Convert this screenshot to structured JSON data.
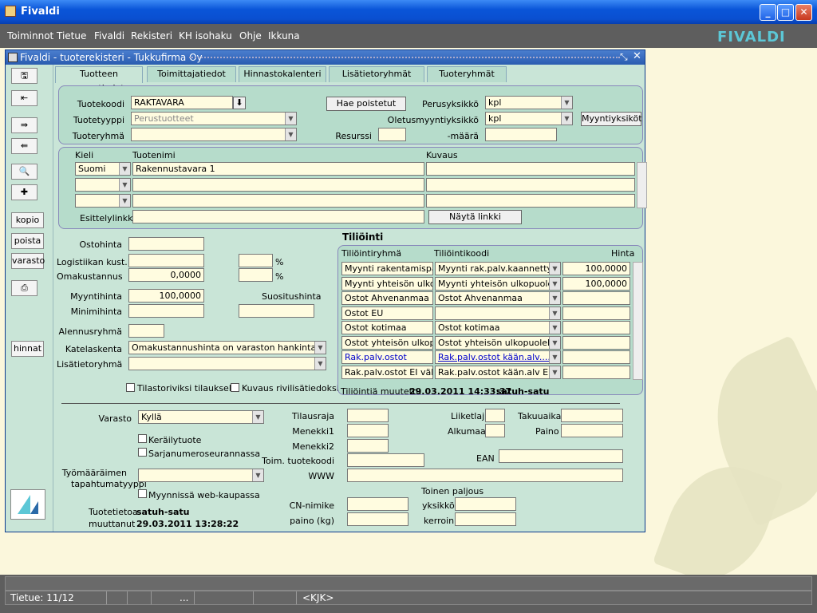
{
  "app": {
    "title": "Fivaldi",
    "logo": "FIVALDI"
  },
  "window_controls": [
    "minimize-icon",
    "maximize-icon",
    "close-icon"
  ],
  "menu": [
    "Toiminnot",
    "Tietue",
    "Fivaldi",
    "Rekisteri",
    "KH isohaku",
    "Ohje",
    "Ikkuna"
  ],
  "subwin": {
    "title": "Fivaldi - tuoterekisteri - Tukkufirma Oy"
  },
  "toolbar": {
    "kopio": "kopio",
    "poista": "poista",
    "varasto": "varasto",
    "hinnat": "hinnat"
  },
  "tabs": [
    "Tuotteen perustiedot",
    "Toimittajatiedot",
    "Hinnastokalenteri",
    "Lisätietoryhmät",
    "Tuoteryhmät"
  ],
  "basic": {
    "tuotekoodi_label": "Tuotekoodi",
    "tuotekoodi": "RAKTAVARA",
    "tuotetyyppi_label": "Tuotetyyppi",
    "tuotetyyppi": "Perustuotteet",
    "tuoteryhma_label": "Tuoteryhmä",
    "hae_button": "Hae poistetut",
    "perusyksikko_label": "Perusyksikkö",
    "perusyksikko": "kpl",
    "oletus_label": "Oletusmyyntiyksikkö",
    "oletus": "kpl",
    "myyntiyksikot_button": "Myyntiyksiköt",
    "resurssi_label": "Resurssi",
    "maara_label": "-määrä"
  },
  "names": {
    "kieli_header": "Kieli",
    "tuotenimi_header": "Tuotenimi",
    "kuvaus_header": "Kuvaus",
    "kieli": "Suomi",
    "tuotenimi": "Rakennustavara 1",
    "esittely_label": "Esittelylinkki",
    "nayta_button": "Näytä linkki"
  },
  "pricing": {
    "ostohinta_label": "Ostohinta",
    "logistiikka_label": "Logistiikan kust.",
    "omakustannus_label": "Omakustannus",
    "omakustannus": "0,0000",
    "pct1": "%",
    "pct2": "%",
    "myyntihinta_label": "Myyntihinta",
    "myyntihinta": "100,0000",
    "suositus_label": "Suositushinta",
    "minimihinta_label": "Minimihinta",
    "alennus_label": "Alennusryhmä",
    "katelaskenta_label": "Katelaskenta",
    "katelaskenta": "Omakustannushinta on varaston hankintahinta",
    "lisatieto_label": "Lisätietoryhmä",
    "tilasto_label": "Tilastoriviksi tilaukselle",
    "kuvaus_rivi_label": "Kuvaus rivilisätiedoksi"
  },
  "tiliointi": {
    "title": "Tiliöinti",
    "col_ryhma": "Tiliöintiryhmä",
    "col_koodi": "Tiliöintikoodi",
    "col_hinta": "Hinta",
    "rows": [
      {
        "ryhma": "Myynti rakentamispalvel",
        "koodi": "Myynti rak.palv.kaannetty ...",
        "hinta": "100,0000"
      },
      {
        "ryhma": "Myynti yhteisön ulkopuo",
        "koodi": "Myynti yhteisön ulkopuolelle",
        "hinta": "100,0000"
      },
      {
        "ryhma": "Ostot Ahvenanmaa",
        "koodi": "Ostot Ahvenanmaa",
        "hinta": ""
      },
      {
        "ryhma": "Ostot EU",
        "koodi": "",
        "hinta": ""
      },
      {
        "ryhma": "Ostot kotimaa",
        "koodi": "Ostot kotimaa",
        "hinta": ""
      },
      {
        "ryhma": "Ostot yhteisön ulkopuole",
        "koodi": "Ostot yhteisön ulkopuolelta",
        "hinta": ""
      },
      {
        "ryhma": "Rak.palv.ostot",
        "koodi": "Rak.palv.ostot kään.alv.........",
        "hinta": ""
      },
      {
        "ryhma": "Rak.palv.ostot EI vähenn",
        "koodi": "Rak.palv.ostot kään.alv EI ...",
        "hinta": ""
      }
    ],
    "changed_label": "Tiliöintiä muutettu",
    "changed_date": "29.03.2011 14:33:37",
    "changed_user": "satuh-satu"
  },
  "stock": {
    "varasto_label": "Varasto",
    "varasto": "Kyllä",
    "keraily_label": "Keräilytuote",
    "sarjanumero_label": "Sarjanumeroseurannassa",
    "tyomaara_label1": "Työmääräimen",
    "tyomaara_label2": "tapahtumatyyppi",
    "web_label": "Myynnissä web-kaupassa",
    "tuotetietoa_label1": "Tuotetietoa",
    "tuotetietoa_label2": "muuttanut",
    "tuotetietoa_user": "satuh-satu",
    "tuotetietoa_date": "29.03.2011 13:28:22",
    "tilausraja_label": "Tilausraja",
    "menekki1_label": "Menekki1",
    "menekki2_label": "Menekki2",
    "toim_label": "Toim. tuotekoodi",
    "www_label": "WWW",
    "liiketlaji_label": "Liiketlaji",
    "alkumaa_label": "Alkumaa",
    "takuuaika_label": "Takuuaika",
    "paino_label": "Paino",
    "ean_label": "EAN",
    "toinen_label": "Toinen paljous",
    "cn_label": "CN-nimike",
    "painokg_label": "paino (kg)",
    "yksikko_label": "yksikkö",
    "kerroin_label": "kerroin"
  },
  "status": {
    "record": "Tietue: 11/12",
    "dots": "...",
    "kjk": "<KJK>"
  }
}
